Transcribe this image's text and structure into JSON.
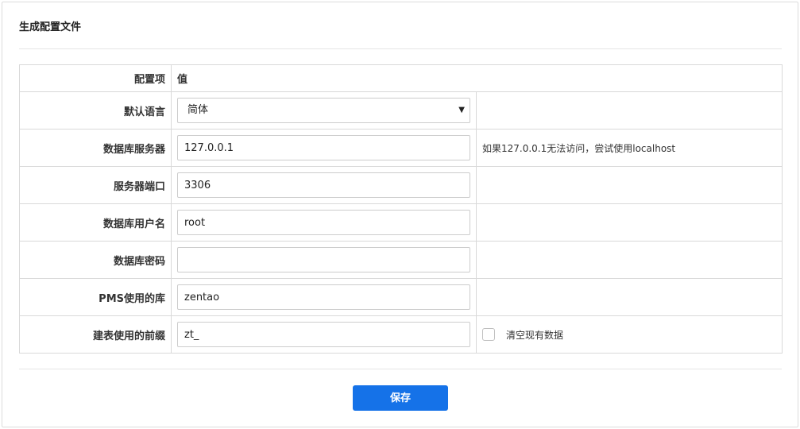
{
  "panel": {
    "title": "生成配置文件"
  },
  "table": {
    "header": {
      "item": "配置项",
      "value": "值"
    },
    "rows": {
      "lang": {
        "label": "默认语言",
        "value": "简体"
      },
      "dbhost": {
        "label": "数据库服务器",
        "value": "127.0.0.1",
        "hint": "如果127.0.0.1无法访问，尝试使用localhost"
      },
      "dbport": {
        "label": "服务器端口",
        "value": "3306"
      },
      "dbuser": {
        "label": "数据库用户名",
        "value": "root"
      },
      "dbpass": {
        "label": "数据库密码",
        "value": ""
      },
      "dbname": {
        "label": "PMS使用的库",
        "value": "zentao"
      },
      "prefix": {
        "label": "建表使用的前缀",
        "value": "zt_",
        "checkbox_label": "清空现有数据",
        "checkbox_checked": false
      }
    }
  },
  "actions": {
    "save_label": "保存"
  },
  "icons": {
    "caret": "caret-down-icon",
    "caret_glyph": "▼"
  },
  "colors": {
    "primary_button": "#1572e8"
  }
}
